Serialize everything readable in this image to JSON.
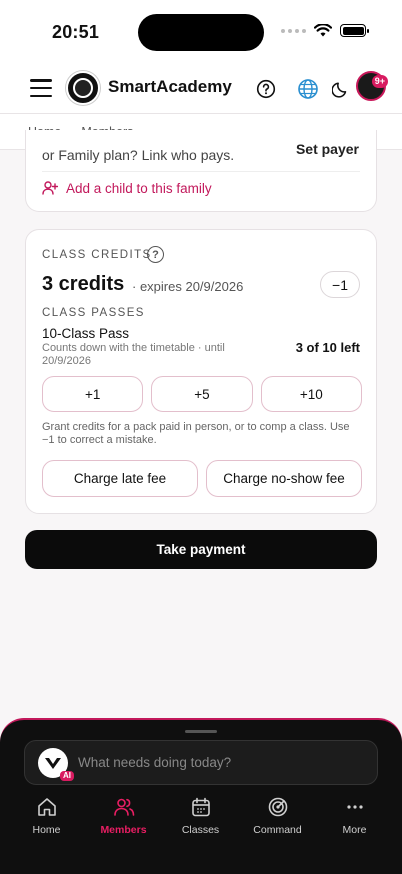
{
  "status": {
    "time": "20:51"
  },
  "header": {
    "app_name": "SmartAcademy",
    "notification_count": "9+"
  },
  "breadcrumb": {
    "home": "Home",
    "current": "Members"
  },
  "family": {
    "text": "or Family plan? Link who pays.",
    "set_payer": "Set payer",
    "add_child": "Add a child to this family"
  },
  "credits": {
    "section_label": "CLASS CREDITS",
    "amount": "3 credits",
    "expiry": "· expires 20/9/2026",
    "minus": "−1",
    "passes_label": "CLASS PASSES",
    "pass_name": "10-Class Pass",
    "pass_sub": "Counts down with the timetable · until 20/9/2026",
    "pass_left": "3 of 10 left",
    "grant_buttons": [
      "+1",
      "+5",
      "+10"
    ],
    "grant_help": "Grant credits for a pack paid in person, or to comp a class. Use −1 to correct a mistake.",
    "late_fee": "Charge late fee",
    "no_show_fee": "Charge no-show fee"
  },
  "take_payment": "Take payment",
  "assistant": {
    "placeholder": "What needs doing today?",
    "tag": "AI"
  },
  "nav": {
    "items": [
      {
        "label": "Home",
        "icon": "home-icon"
      },
      {
        "label": "Members",
        "icon": "members-icon",
        "active": true
      },
      {
        "label": "Classes",
        "icon": "calendar-icon"
      },
      {
        "label": "Command",
        "icon": "radar-icon"
      },
      {
        "label": "More",
        "icon": "more-icon"
      }
    ]
  },
  "colors": {
    "accent": "#c2185b",
    "dark": "#0b0b0b"
  }
}
